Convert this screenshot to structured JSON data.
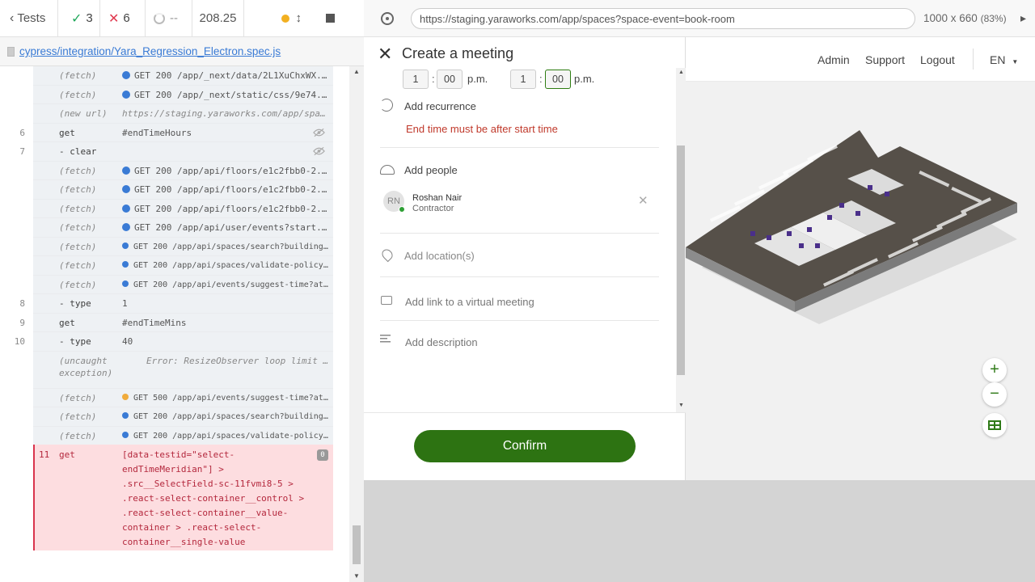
{
  "reporter": {
    "back_label": "Tests",
    "passed": "3",
    "failed": "6",
    "pending": "--",
    "duration": "208.25",
    "spec_path": "cypress/integration/Yara_Regression_Electron.spec.js",
    "commands": [
      {
        "num": "",
        "name": "(fetch)",
        "pending": true,
        "dot": "blue",
        "msg": "GET 200 /app/_next/data/2L1XuChxWX...",
        "style": "normal"
      },
      {
        "num": "",
        "name": "(fetch)",
        "pending": true,
        "dot": "blue",
        "msg": "GET 200 /app/_next/static/css/9e74...",
        "style": "normal"
      },
      {
        "num": "",
        "name": "(new url)",
        "pending": true,
        "dot": "",
        "msg": "https://staging.yaraworks.com/app/spa...",
        "style": "dim"
      },
      {
        "num": "6",
        "name": "get",
        "pending": false,
        "dot": "",
        "msg": "#endTimeHours",
        "style": "normal",
        "eye": true
      },
      {
        "num": "7",
        "name": " - clear",
        "pending": false,
        "dot": "",
        "msg": "",
        "style": "normal",
        "eye": true
      },
      {
        "num": "",
        "name": "(fetch)",
        "pending": true,
        "dot": "blue",
        "msg": "GET 200 /app/api/floors/e1c2fbb0-2...",
        "style": "normal"
      },
      {
        "num": "",
        "name": "(fetch)",
        "pending": true,
        "dot": "blue",
        "msg": "GET 200 /app/api/floors/e1c2fbb0-2...",
        "style": "normal"
      },
      {
        "num": "",
        "name": "(fetch)",
        "pending": true,
        "dot": "blue",
        "msg": "GET 200 /app/api/floors/e1c2fbb0-2...",
        "style": "normal"
      },
      {
        "num": "",
        "name": "(fetch)",
        "pending": true,
        "dot": "blue",
        "msg": "GET 200 /app/api/user/events?start...",
        "style": "normal"
      },
      {
        "num": "",
        "name": "(fetch)",
        "pending": true,
        "dot": "blue-s",
        "msg": "GET 200 /app/api/spaces/search?buildingUu...",
        "style": "small"
      },
      {
        "num": "",
        "name": "(fetch)",
        "pending": true,
        "dot": "blue-s",
        "msg": "GET 200 /app/api/spaces/validate-policy?s...",
        "style": "small"
      },
      {
        "num": "",
        "name": "(fetch)",
        "pending": true,
        "dot": "blue-s",
        "msg": "GET 200 /app/api/events/suggest-time?atte...",
        "style": "small"
      },
      {
        "num": "8",
        "name": " - type",
        "pending": false,
        "dot": "",
        "msg": "1",
        "style": "normal"
      },
      {
        "num": "9",
        "name": "get",
        "pending": false,
        "dot": "",
        "msg": "#endTimeMins",
        "style": "normal"
      },
      {
        "num": "10",
        "name": " - type",
        "pending": false,
        "dot": "",
        "msg": "40",
        "style": "normal"
      }
    ],
    "exception": {
      "name1": "(uncaught",
      "name2": "exception)",
      "msg": "Error: ResizeObserver loop limit ..."
    },
    "commands2": [
      {
        "name": "(fetch)",
        "dot": "orange",
        "msg": "GET 500 /app/api/events/suggest-time?atte..."
      },
      {
        "name": "(fetch)",
        "dot": "blue",
        "msg": "GET 200 /app/api/spaces/search?buildingUu..."
      },
      {
        "name": "(fetch)",
        "dot": "blue",
        "msg": "GET 200 /app/api/spaces/validate-policy?s..."
      }
    ],
    "failed_command": {
      "num": "11",
      "name": "get",
      "selector": "[data-testid=\"select-endTimeMeridian\"] > .src__SelectField-sc-11fvmi8-5 > .react-select-container__control > .react-select-container__value-container > .react-select-container__single-value",
      "badge": "0"
    }
  },
  "browser": {
    "url": "https://staging.yaraworks.com/app/spaces?space-event=book-room",
    "viewport": "1000 x 660",
    "zoom": "(83%)"
  },
  "app_header": {
    "links": [
      "Admin",
      "Support",
      "Logout"
    ],
    "language": "EN"
  },
  "modal": {
    "title": "Create a meeting",
    "start_hour": "1",
    "start_min": "00",
    "start_meridian": "p.m.",
    "end_hour": "1",
    "end_min": "00",
    "end_meridian": "p.m.",
    "add_recurrence": "Add recurrence",
    "error": "End time must be after start time",
    "add_people": "Add people",
    "person": {
      "initials": "RN",
      "name": "Roshan Nair",
      "role": "Contractor"
    },
    "add_location": "Add location(s)",
    "add_virtual": "Add link to a virtual meeting",
    "add_description": "Add description",
    "confirm": "Confirm"
  },
  "colors": {
    "accent_green": "#2d7312",
    "error_red": "#c0392b",
    "link_blue": "#3a7bd5"
  }
}
